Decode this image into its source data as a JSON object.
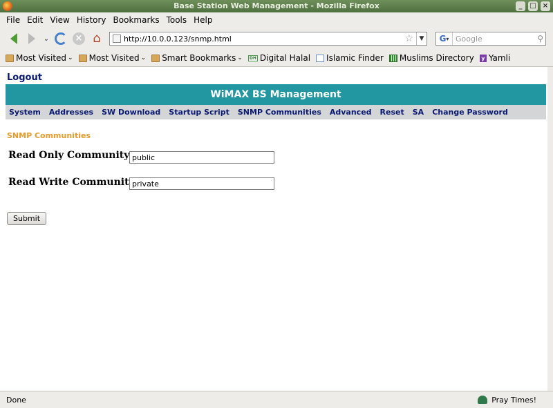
{
  "window": {
    "title": "Base Station Web Management - Mozilla Firefox",
    "controls": [
      "_",
      "□",
      "×"
    ]
  },
  "menubar": {
    "items": [
      "File",
      "Edit",
      "View",
      "History",
      "Bookmarks",
      "Tools",
      "Help"
    ]
  },
  "navbar": {
    "url": "http://10.0.0.123/snmp.html",
    "search_placeholder": "Google",
    "search_engine_glyph": "G"
  },
  "bookmarks": {
    "items": [
      {
        "label": "Most Visited",
        "icon": "folder-icon",
        "dropdown": true
      },
      {
        "label": "Most Visited",
        "icon": "folder-icon",
        "dropdown": true
      },
      {
        "label": "Smart Bookmarks",
        "icon": "folder-icon",
        "dropdown": true
      },
      {
        "label": "Digital Halal",
        "icon": "digital-halal-icon",
        "dropdown": false
      },
      {
        "label": "Islamic Finder",
        "icon": "islamic-finder-icon",
        "dropdown": false
      },
      {
        "label": "Muslims Directory",
        "icon": "muslims-directory-icon",
        "dropdown": false
      },
      {
        "label": "Yamli",
        "icon": "yamli-icon",
        "dropdown": false
      }
    ],
    "digital_halal_glyph": "DH",
    "yamli_glyph": "y"
  },
  "page": {
    "logout": "Logout",
    "banner": "WiMAX BS Management",
    "nav": [
      "System",
      "Addresses",
      "SW Download",
      "Startup Script",
      "SNMP Communities",
      "Advanced",
      "Reset",
      "SA",
      "Change Password"
    ],
    "section_title": "SNMP Communities",
    "form": {
      "read_only_label": "Read Only Community:",
      "read_only_value": "public",
      "read_write_label": "Read Write Community:",
      "read_write_value": "private",
      "submit_label": "Submit"
    }
  },
  "statusbar": {
    "status": "Done",
    "pray_times": "Pray Times!"
  },
  "colors": {
    "banner_bg": "#2297a1",
    "nav_link": "#0a1a72",
    "section_title": "#e89b2c",
    "titlebar": "#4f7140"
  }
}
